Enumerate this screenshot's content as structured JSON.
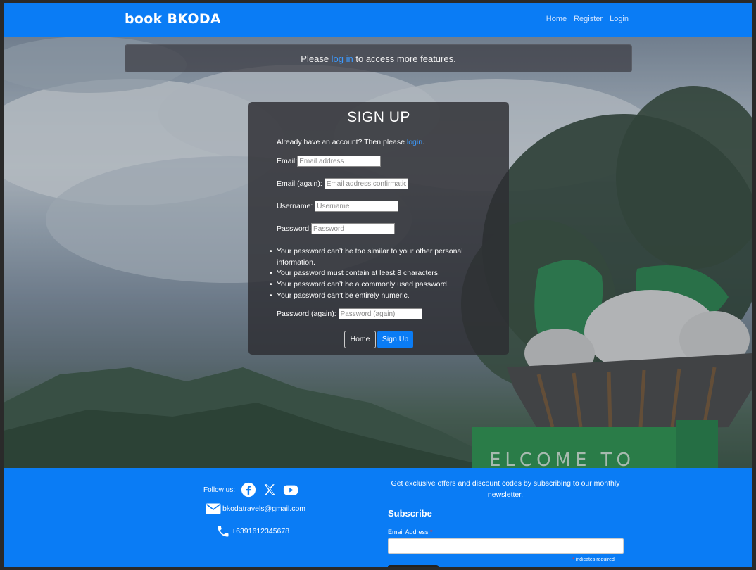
{
  "header": {
    "brand": "book BKODA",
    "nav": [
      "Home",
      "Register",
      "Login"
    ]
  },
  "alert": {
    "before": "Please ",
    "link": "log in",
    "after": " to access more features."
  },
  "signup": {
    "title": "SIGN UP",
    "account_prefix": "Already have an account? Then please ",
    "account_link": "login",
    "account_suffix": ".",
    "email_label": "Email:",
    "email_placeholder": "Email address",
    "email2_label": "Email (again):",
    "email2_placeholder": "Email address confirmation",
    "username_label": "Username:",
    "username_placeholder": "Username",
    "password_label": "Password:",
    "password_placeholder": "Password",
    "hints": [
      "Your password can’t be too similar to your other personal information.",
      "Your password must contain at least 8 characters.",
      "Your password can’t be a commonly used password.",
      "Your password can’t be entirely numeric."
    ],
    "password2_label": "Password (again):",
    "password2_placeholder": "Password (again)",
    "home_button": "Home",
    "signup_button": "Sign Up"
  },
  "footer": {
    "follow_label": "Follow us:",
    "social_icons": [
      "facebook-icon",
      "x-icon",
      "youtube-icon"
    ],
    "email": "bkodatravels@gmail.com",
    "phone": "+6391612345678",
    "offer": "Get exclusive offers and discount codes by subscribing to our monthly newsletter.",
    "subscribe_title": "Subscribe",
    "email_field_label": "Email Address",
    "required_marker": "*",
    "required_note": "indicates required"
  },
  "colors": {
    "brand_blue": "#0a7cf5",
    "link_blue": "#3d9bff",
    "required_red": "#e33"
  }
}
